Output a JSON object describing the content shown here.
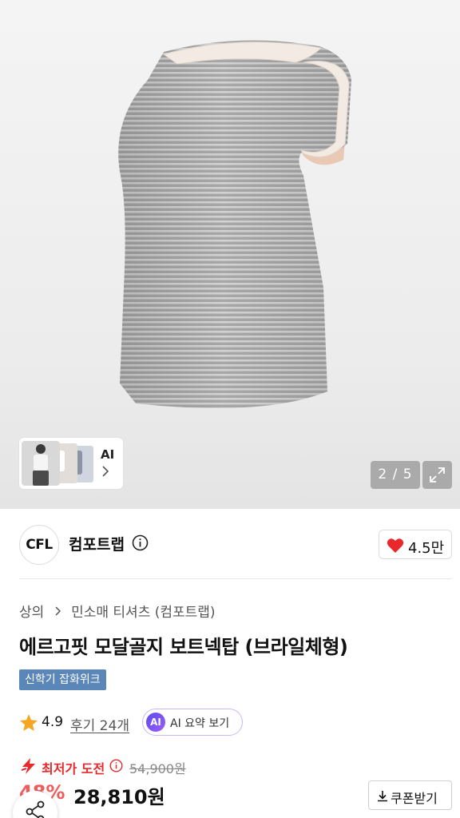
{
  "gallery": {
    "counter": "2 / 5",
    "ai_label": "AI"
  },
  "brand": {
    "logo_text": "CFL",
    "name": "컴포트랩",
    "likes": "4.5만"
  },
  "product": {
    "breadcrumb": [
      "상의",
      "민소매 티셔츠 (컴포트랩)"
    ],
    "title": "에르고핏 모달골지 보트넥탑 (브라일체형)",
    "tag": "신학기 잡화위크",
    "rating": "4.9",
    "reviews": "후기 24개",
    "ai_summary": {
      "badge": "AI",
      "label": "AI 요약 보기"
    },
    "lowest_label": "최저가 도전",
    "original_price": "54,900원",
    "discount": "48%",
    "price": "28,810원",
    "coupon_label": "쿠폰받기"
  },
  "colors": {
    "accent_red": "#e8282b",
    "tag_blue": "#5a87b8",
    "ai_purple": "#7c5cf0"
  },
  "icons": [
    "chevron-right-icon",
    "expand-icon",
    "info-icon",
    "heart-icon",
    "star-icon",
    "bolt-icon",
    "download-icon",
    "share-icon"
  ]
}
